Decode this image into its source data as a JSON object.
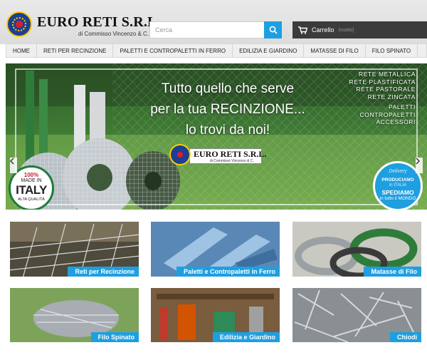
{
  "header": {
    "logo_name": "EURO RETI S.R.L.",
    "logo_sub": "di Commisso Vincenzo & C.",
    "search_placeholder": "Cerca",
    "cart_label": "Carrello",
    "cart_status": "(vuoto)"
  },
  "nav": {
    "items": [
      "HOME",
      "RETI PER RECINZIONE",
      "PALETTI E CONTROPALETTI IN FERRO",
      "EDILIZIA E GIARDINO",
      "MATASSE DI FILO",
      "FILO SPINATO"
    ]
  },
  "hero": {
    "line1": "Tutto quello che serve",
    "line2": "per la tua RECINZIONE...",
    "line3": "lo trovi da noi!",
    "products_a": [
      "RETE METALLICA",
      "RETE PLASTIFICATA",
      "RETE PASTORALE",
      "RETE ZINCATA"
    ],
    "products_b": [
      "PALETTI",
      "CONTROPALETTI",
      "ACCESSORI"
    ],
    "logo_name": "EURO RETI S.R.L.",
    "logo_sub": "di Commisso Vincenzo & C.",
    "made_pct": "100%",
    "made_label": "MADE IN",
    "made_country": "ITALY",
    "made_quality": "ALTA QUALITÀ",
    "delivery_title": "Delivery",
    "delivery_prod": "PRODUCIAMO",
    "delivery_sub": "in ITALIA",
    "delivery_big": "SPEDIAMO",
    "delivery_world": "in tutto il MONDO"
  },
  "categories": [
    {
      "label": "Reti per Recinzione"
    },
    {
      "label": "Paletti e Contropaletti in Ferro"
    },
    {
      "label": "Matasse di Filo"
    },
    {
      "label": "Filo Spinato"
    },
    {
      "label": "Edilizia e Giardino"
    },
    {
      "label": "Chiodi"
    }
  ],
  "colors": {
    "accent": "#1e9fe0",
    "cart_bg": "#3b3b3b",
    "italy_green": "#1f7a3a",
    "italy_red": "#c21f2f"
  }
}
